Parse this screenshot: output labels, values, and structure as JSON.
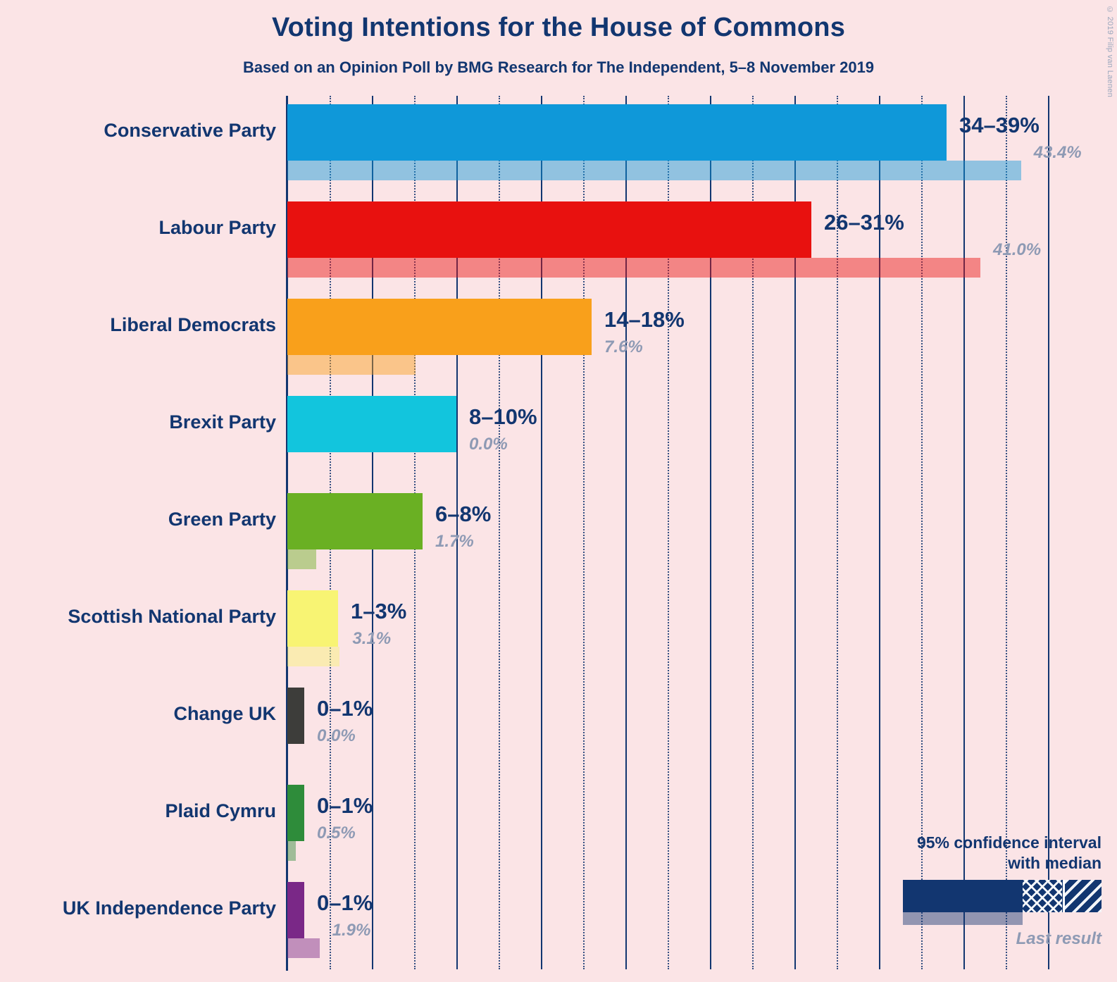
{
  "header": {
    "title": "Voting Intentions for the House of Commons",
    "subtitle": "Based on an Opinion Poll by BMG Research for The Independent, 5–8 November 2019",
    "copyright": "© 2019 Filip van Laenen"
  },
  "legend": {
    "line1": "95% confidence interval",
    "line2": "with median",
    "last_result": "Last result"
  },
  "colors": {
    "background": "#FBE4E6",
    "text": "#123670",
    "muted": "#8e9ab4",
    "conservative": "#0F98D9",
    "labour": "#E8110F",
    "libdem": "#F9A01B",
    "brexit": "#12C5DD",
    "green": "#6AB023",
    "snp": "#F8F473",
    "changeuk": "#3D3D3A",
    "plaid": "#2E8C3A",
    "ukip": "#7A2887"
  },
  "chart_data": {
    "type": "bar",
    "title": "Voting Intentions for the House of Commons",
    "subtitle": "Based on an Opinion Poll by BMG Research for The Independent, 5–8 November 2019",
    "xlabel": "",
    "ylabel": "",
    "xlim": [
      0,
      45
    ],
    "grid": true,
    "legend_position": "bottom-right",
    "categories": [
      "Conservative Party",
      "Labour Party",
      "Liberal Democrats",
      "Brexit Party",
      "Green Party",
      "Scottish National Party",
      "Change UK",
      "Plaid Cymru",
      "UK Independence Party"
    ],
    "series": [
      {
        "name": "95% confidence interval (low)",
        "values": [
          34,
          26,
          14,
          8,
          6,
          1,
          0,
          0,
          0
        ]
      },
      {
        "name": "95% confidence interval (high)",
        "values": [
          39,
          31,
          18,
          10,
          8,
          3,
          1,
          1,
          1
        ]
      },
      {
        "name": "Last result",
        "values": [
          43.4,
          41.0,
          7.6,
          0.0,
          1.7,
          3.1,
          0.0,
          0.5,
          1.9
        ]
      }
    ],
    "parties": [
      {
        "label": "Conservative Party",
        "ci_text": "34–39%",
        "last_text": "43.4%",
        "low": 34,
        "median": 37,
        "high": 39,
        "last": 43.4,
        "color": "#0F98D9"
      },
      {
        "label": "Labour Party",
        "ci_text": "26–31%",
        "last_text": "41.0%",
        "low": 26,
        "median": 29,
        "high": 31,
        "last": 41.0,
        "color": "#E8110F"
      },
      {
        "label": "Liberal Democrats",
        "ci_text": "14–18%",
        "last_text": "7.6%",
        "low": 14,
        "median": 16,
        "high": 18,
        "last": 7.6,
        "color": "#F9A01B"
      },
      {
        "label": "Brexit Party",
        "ci_text": "8–10%",
        "last_text": "0.0%",
        "low": 8,
        "median": 9,
        "high": 10,
        "last": 0.0,
        "color": "#12C5DD"
      },
      {
        "label": "Green Party",
        "ci_text": "6–8%",
        "last_text": "1.7%",
        "low": 6,
        "median": 7,
        "high": 8,
        "last": 1.7,
        "color": "#6AB023"
      },
      {
        "label": "Scottish National Party",
        "ci_text": "1–3%",
        "last_text": "3.1%",
        "low": 1,
        "median": 2,
        "high": 3,
        "last": 3.1,
        "color": "#F8F473"
      },
      {
        "label": "Change UK",
        "ci_text": "0–1%",
        "last_text": "0.0%",
        "low": 0,
        "median": 0.4,
        "high": 1,
        "last": 0.0,
        "color": "#3D3D3A"
      },
      {
        "label": "Plaid Cymru",
        "ci_text": "0–1%",
        "last_text": "0.5%",
        "low": 0,
        "median": 0.4,
        "high": 1,
        "last": 0.5,
        "color": "#2E8C3A"
      },
      {
        "label": "UK Independence Party",
        "ci_text": "0–1%",
        "last_text": "1.9%",
        "low": 0,
        "median": 0.4,
        "high": 1,
        "last": 1.9,
        "color": "#7A2887"
      }
    ]
  }
}
